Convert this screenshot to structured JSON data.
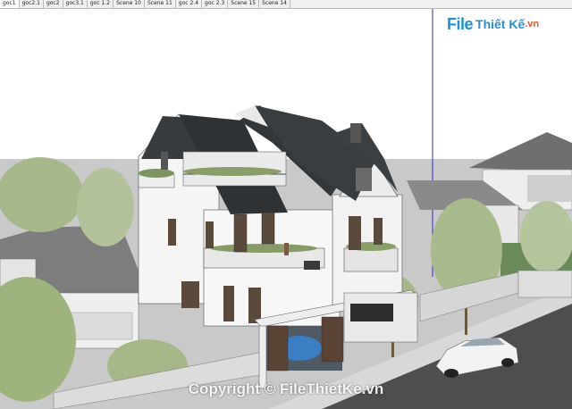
{
  "scene_tabs": [
    {
      "label": "goc1",
      "active": true
    },
    {
      "label": "goc2.1",
      "active": false
    },
    {
      "label": "goc2",
      "active": false
    },
    {
      "label": "goc3.1",
      "active": false
    },
    {
      "label": "goc 1.2",
      "active": false
    },
    {
      "label": "Scene 10",
      "active": false
    },
    {
      "label": "Scene 11",
      "active": false
    },
    {
      "label": "goc 2.4",
      "active": false
    },
    {
      "label": "goc 2.3",
      "active": false
    },
    {
      "label": "Scene 15",
      "active": false
    },
    {
      "label": "Scene 14",
      "active": false
    }
  ],
  "logo": {
    "file": "File",
    "rest": "Thiết Kế",
    "tld": ".vn"
  },
  "watermark": "Copyright © FileThietKe.vn",
  "colors": {
    "sky": "#ffffff",
    "ground": "#c8c8c8",
    "roof": "#3a3d40",
    "wall": "#f4f4f4",
    "tree": "#a9b98a",
    "axis": "#2a2ad8",
    "road": "#4a4a4a"
  }
}
